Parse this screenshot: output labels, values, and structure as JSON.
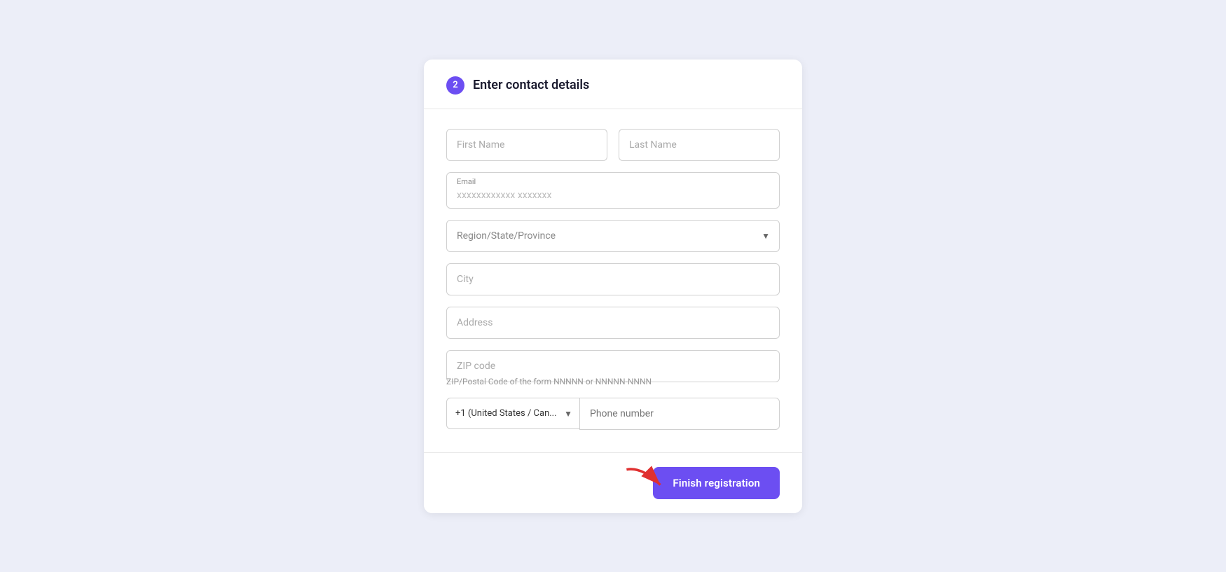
{
  "form": {
    "step": "2",
    "title": "Enter contact details",
    "fields": {
      "first_name_placeholder": "First Name",
      "last_name_placeholder": "Last Name",
      "email_label": "Email",
      "email_value": "xxxxxxxxxxxx xxxxxxx",
      "region_placeholder": "Region/State/Province",
      "city_placeholder": "City",
      "address_placeholder": "Address",
      "zip_placeholder": "ZIP code",
      "zip_hint": "ZIP/Postal Code of the form NNNNN or NNNNN-NNNN",
      "phone_country_default": "+1 (United States / Can...",
      "phone_number_placeholder": "Phone number"
    },
    "footer": {
      "finish_button": "Finish registration"
    }
  }
}
